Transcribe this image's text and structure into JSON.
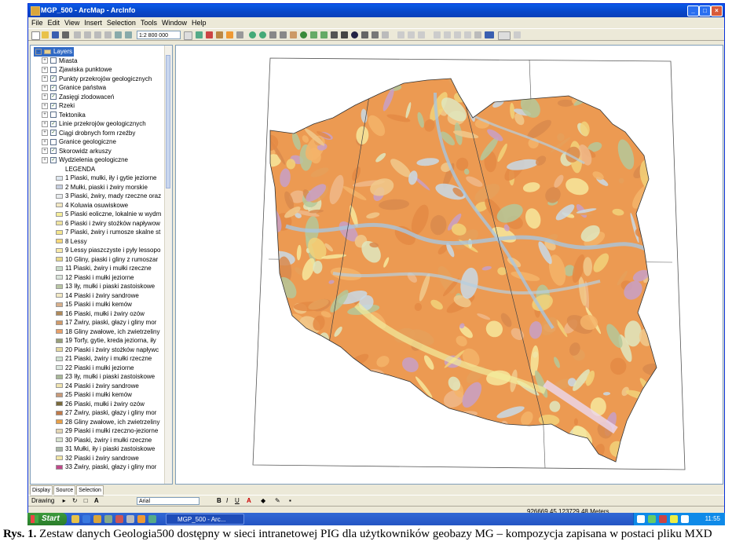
{
  "window": {
    "title": "MGP_500 - ArcMap - ArcInfo"
  },
  "menu": [
    "File",
    "Edit",
    "View",
    "Insert",
    "Selection",
    "Tools",
    "Window",
    "Help"
  ],
  "toolbar": {
    "scale": "1:2 800 000"
  },
  "toc": {
    "root": "Layers",
    "layers": [
      {
        "label": "Miasta",
        "checked": false
      },
      {
        "label": "Zjawiska punktowe",
        "checked": false
      },
      {
        "label": "Punkty przekrojów geologicznych",
        "checked": true
      },
      {
        "label": "Granice państwa",
        "checked": true
      },
      {
        "label": "Zasięgi zlodowaceń",
        "checked": true
      },
      {
        "label": "Rzeki",
        "checked": true
      },
      {
        "label": "Tektonika",
        "checked": false
      },
      {
        "label": "Linie przekrojów geologicznych",
        "checked": true
      },
      {
        "label": "Ciągi drobnych form rzeźby",
        "checked": true
      },
      {
        "label": "Granice geologiczne",
        "checked": false
      },
      {
        "label": "Skorowidz arkuszy",
        "checked": true
      },
      {
        "label": "Wydzielenia geologiczne",
        "checked": true
      }
    ],
    "legend_title": "LEGENDA",
    "legend": [
      {
        "label": "1 Piaski, mułki, iły i gytie jeziorne",
        "color": "#dfe7f0"
      },
      {
        "label": "2 Mułki, piaski i żwiry morskie",
        "color": "#c6cfe0"
      },
      {
        "label": "3 Piaski, żwiry, mady rzeczne oraz",
        "color": "#e8ecef"
      },
      {
        "label": "4 Koluwia osuwiskowe",
        "color": "#f2e7c2"
      },
      {
        "label": "5 Piaski eoliczne, lokalnie w wydm",
        "color": "#f6ee9a"
      },
      {
        "label": "6 Piaski i żwiry stożków napływow",
        "color": "#efe3a0"
      },
      {
        "label": "7 Piaski, żwiry i rumosze skalne st",
        "color": "#f4e58c"
      },
      {
        "label": "8 Lessy",
        "color": "#f5d77a"
      },
      {
        "label": "9 Lessy piaszczyste i pyły lessopo",
        "color": "#f8e9a8"
      },
      {
        "label": "10 Gliny, piaski i gliny z rumoszar",
        "color": "#e8d88a"
      },
      {
        "label": "11 Piaski, żwiry i mułki rzeczne",
        "color": "#c9dbc9"
      },
      {
        "label": "12 Piaski i mułki jeziorne",
        "color": "#dbe6dc"
      },
      {
        "label": "13 Iły, mułki i piaski zastoiskowe",
        "color": "#b9c7a4"
      },
      {
        "label": "14 Piaski i żwiry sandrowe",
        "color": "#f3e9c4"
      },
      {
        "label": "15 Piaski i mułki kemów",
        "color": "#d8b08c"
      },
      {
        "label": "16 Piaski, mułki i żwiry ozów",
        "color": "#b08a5a"
      },
      {
        "label": "17 Żwiry, piaski, głazy i gliny mor",
        "color": "#d09a6a"
      },
      {
        "label": "18 Gliny zwałowe, ich zwietrzeliny",
        "color": "#e7a06a"
      },
      {
        "label": "19 Torfy, gytie, kreda jeziorna, iły",
        "color": "#9aa07a"
      },
      {
        "label": "20 Piaski i żwiry stożków napływc",
        "color": "#e6d8a0"
      },
      {
        "label": "21 Piaski, żwiry i mułki rzeczne",
        "color": "#cfe0d0"
      },
      {
        "label": "22 Piaski i mułki jeziorne",
        "color": "#dde8e0"
      },
      {
        "label": "23 Iły, mułki i piaski zastoiskowe",
        "color": "#a8b898"
      },
      {
        "label": "24 Piaski i żwiry sandrowe",
        "color": "#f0e4b0"
      },
      {
        "label": "25 Piaski i mułki kemów",
        "color": "#c89a7a"
      },
      {
        "label": "26 Piaski, mułki i żwiry ozów",
        "color": "#7a6a3a"
      },
      {
        "label": "27 Żwiry, piaski, głazy i gliny mor",
        "color": "#c07a4a"
      },
      {
        "label": "28 Gliny zwałowe, ich zwietrzeliny",
        "color": "#e8a048"
      },
      {
        "label": "29 Piaski i mułki rzeczno-jeziorne",
        "color": "#e4d6b4"
      },
      {
        "label": "30 Piaski, żwiry i mułki rzeczne",
        "color": "#d6e2cc"
      },
      {
        "label": "31 Mułki, iły i piaski zastoiskowe",
        "color": "#aab8a8"
      },
      {
        "label": "32 Piaski i żwiry sandrowe",
        "color": "#f2e6a6"
      },
      {
        "label": "33 Żwiry, piaski, głazy i gliny mor",
        "color": "#c0488a"
      }
    ],
    "tabs": [
      "Display",
      "Source",
      "Selection"
    ]
  },
  "drawing": {
    "label": "Drawing",
    "font": "Arial"
  },
  "status": {
    "coords": "926669.45  123729.48 Meters"
  },
  "taskbar": {
    "start": "Start",
    "task": "MGP_500 - Arc...",
    "clock": "11:55"
  },
  "caption": {
    "prefix": "Rys. 1.",
    "text": "Zestaw danych Geologia500 dostępny w sieci intranetowej PIG dla użytkowników geobazy MG – kompozycja zapisana w postaci pliku MXD"
  }
}
